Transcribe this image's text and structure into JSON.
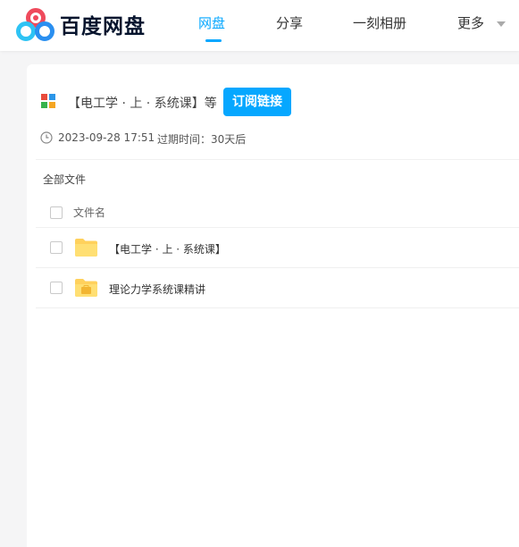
{
  "header": {
    "brand": "百度网盘",
    "nav": [
      {
        "label": "网盘",
        "active": true
      },
      {
        "label": "分享",
        "active": false
      },
      {
        "label": "一刻相册",
        "active": false
      },
      {
        "label": "更多",
        "active": false
      }
    ],
    "accent_color": "#06a7ff"
  },
  "share": {
    "title": "【电工学 · 上 · 系统课】等",
    "subscribe_label": "订阅链接",
    "date": "2023-09-28 17:51",
    "expiry": "过期时间：30天后"
  },
  "breadcrumb": "全部文件",
  "table": {
    "column_filename": "文件名",
    "rows": [
      {
        "name": "【电工学 · 上 · 系统课】",
        "icon": "folder-icon"
      },
      {
        "name": "理论力学系统课精讲",
        "icon": "briefcase-folder-icon"
      }
    ]
  }
}
